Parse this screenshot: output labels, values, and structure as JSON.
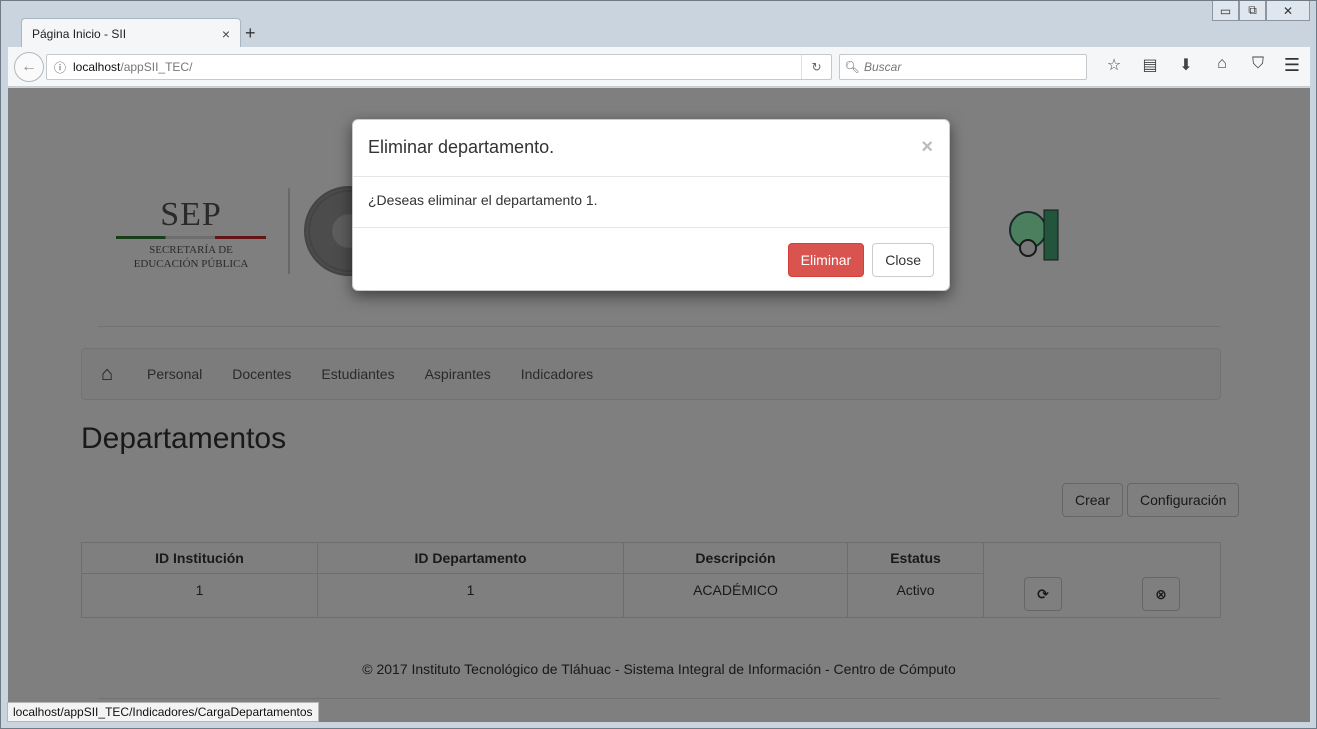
{
  "browser": {
    "tab_title": "Página Inicio - SII",
    "tab_close": "×",
    "new_tab": "+",
    "url_host": "localhost",
    "url_path": "/appSII_TEC/",
    "search_placeholder": "Buscar",
    "status_url": "localhost/appSII_TEC/Indicadores/CargaDepartamentos"
  },
  "logos": {
    "sep_word": "SEP",
    "sep_line1": "SECRETARÍA DE",
    "sep_line2": "EDUCACIÓN PÚBLICA"
  },
  "nav": {
    "items": [
      "Personal",
      "Docentes",
      "Estudiantes",
      "Aspirantes",
      "Indicadores"
    ]
  },
  "page": {
    "title": "Departamentos",
    "create_label": "Crear",
    "config_label": "Configuración"
  },
  "table": {
    "headers": [
      "ID Institución",
      "ID Departamento",
      "Descripción",
      "Estatus",
      ""
    ],
    "rows": [
      {
        "id_institucion": "1",
        "id_departamento": "1",
        "descripcion": "ACADÉMICO",
        "estatus": "Activo"
      }
    ]
  },
  "footer": {
    "text": "© 2017 Instituto Tecnológico de Tláhuac - Sistema Integral de Información - Centro de Cómputo"
  },
  "modal": {
    "title": "Eliminar departamento.",
    "close_glyph": "×",
    "body": "¿Deseas eliminar el departamento 1.",
    "confirm_label": "Eliminar",
    "close_label": "Close"
  },
  "colors": {
    "danger": "#d9534f",
    "overlay": "rgba(0,0,0,0.5)"
  }
}
